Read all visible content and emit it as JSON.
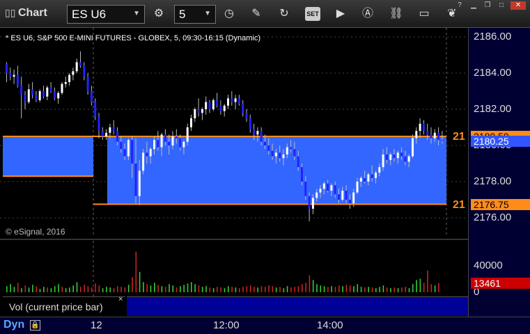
{
  "toolbar": {
    "app_title": "Chart",
    "symbol": "ES U6",
    "interval": "5"
  },
  "chart": {
    "title": "* ES U6, S&P 500 E-MINI FUTURES - GLOBEX, 5, 09:30-16:15 (Dynamic)",
    "copyright": "© eSignal, 2016",
    "price_ticks": [
      "2186.00",
      "2184.00",
      "2182.00",
      "2180.00",
      "2178.00",
      "2176.00"
    ],
    "last_price_tag": "2180.25",
    "upper_level_tag": "2180.50",
    "lower_level_tag": "2176.75",
    "level_prefix": "21",
    "volume_ticks": [
      "40000",
      "0"
    ],
    "volume_tag": "13461",
    "volume_label": "Vol (current price bar)",
    "volume_close": "×",
    "time_labels": [
      "12",
      "12:00",
      "14:00"
    ],
    "dyn_label": "Dyn",
    "colors": {
      "up_candle": "#ffffff",
      "down_candle": "#2222ff",
      "band": "#3366ff",
      "level_line": "#ff8c1a",
      "vol_up": "#33cc33",
      "vol_down": "#cc2222"
    }
  },
  "chart_data": {
    "type": "candlestick",
    "ylim": [
      2175.5,
      2186.3
    ],
    "upper_level": 2180.5,
    "lower_level": 2176.75,
    "last_price": 2180.25,
    "session_break_index": 34,
    "candles": [
      [
        2184.5,
        2184.6,
        2183.5,
        2184.0
      ],
      [
        2184.0,
        2184.3,
        2183.6,
        2183.8
      ],
      [
        2183.8,
        2184.2,
        2183.4,
        2183.9
      ],
      [
        2183.9,
        2184.4,
        2183.2,
        2183.3
      ],
      [
        2183.3,
        2183.8,
        2181.5,
        2182.8
      ],
      [
        2182.8,
        2183.0,
        2182.0,
        2182.4
      ],
      [
        2182.4,
        2183.4,
        2182.3,
        2183.1
      ],
      [
        2183.1,
        2183.5,
        2182.6,
        2182.8
      ],
      [
        2182.8,
        2183.0,
        2182.4,
        2182.5
      ],
      [
        2182.5,
        2183.1,
        2182.4,
        2183.0
      ],
      [
        2183.0,
        2183.3,
        2182.6,
        2182.7
      ],
      [
        2182.7,
        2183.3,
        2182.5,
        2183.2
      ],
      [
        2183.2,
        2183.5,
        2182.9,
        2183.0
      ],
      [
        2183.0,
        2183.2,
        2182.5,
        2182.6
      ],
      [
        2182.6,
        2183.0,
        2182.3,
        2182.9
      ],
      [
        2182.9,
        2183.5,
        2182.8,
        2183.4
      ],
      [
        2183.4,
        2183.8,
        2183.2,
        2183.5
      ],
      [
        2183.5,
        2184.0,
        2183.3,
        2183.9
      ],
      [
        2183.9,
        2184.3,
        2183.6,
        2184.1
      ],
      [
        2184.1,
        2184.8,
        2184.0,
        2184.6
      ],
      [
        2184.6,
        2185.2,
        2184.3,
        2184.4
      ],
      [
        2184.4,
        2184.6,
        2183.6,
        2183.8
      ],
      [
        2183.8,
        2184.0,
        2182.8,
        2183.0
      ],
      [
        2183.0,
        2183.3,
        2182.2,
        2182.4
      ],
      [
        2182.4,
        2182.6,
        2181.4,
        2181.6
      ],
      [
        2181.6,
        2181.8,
        2180.4,
        2180.8
      ],
      [
        2180.8,
        2181.0,
        2180.3,
        2180.5
      ],
      [
        2180.5,
        2180.9,
        2180.3,
        2180.7
      ],
      [
        2180.7,
        2181.2,
        2180.4,
        2181.0
      ],
      [
        2181.0,
        2181.4,
        2180.6,
        2180.8
      ],
      [
        2180.8,
        2181.0,
        2180.0,
        2180.2
      ],
      [
        2180.2,
        2180.5,
        2179.6,
        2179.8
      ],
      [
        2179.8,
        2180.1,
        2179.2,
        2179.4
      ],
      [
        2179.4,
        2180.4,
        2179.2,
        2180.3
      ],
      [
        2180.3,
        2180.5,
        2178.2,
        2179.0
      ],
      [
        2179.0,
        2180.4,
        2176.8,
        2177.2
      ],
      [
        2177.2,
        2179.2,
        2176.7,
        2178.6
      ],
      [
        2178.6,
        2179.8,
        2178.4,
        2179.6
      ],
      [
        2179.6,
        2180.2,
        2179.0,
        2179.4
      ],
      [
        2179.4,
        2179.9,
        2179.0,
        2179.8
      ],
      [
        2179.8,
        2180.5,
        2179.5,
        2180.3
      ],
      [
        2180.3,
        2180.8,
        2179.7,
        2179.9
      ],
      [
        2179.9,
        2180.7,
        2179.4,
        2180.6
      ],
      [
        2180.6,
        2180.9,
        2180.0,
        2180.2
      ],
      [
        2180.2,
        2180.6,
        2179.5,
        2180.0
      ],
      [
        2180.0,
        2180.8,
        2179.8,
        2180.5
      ],
      [
        2180.5,
        2180.9,
        2180.1,
        2180.4
      ],
      [
        2180.4,
        2180.6,
        2179.7,
        2179.9
      ],
      [
        2179.9,
        2180.3,
        2179.5,
        2180.2
      ],
      [
        2180.2,
        2181.2,
        2180.0,
        2181.0
      ],
      [
        2181.0,
        2181.7,
        2180.8,
        2181.5
      ],
      [
        2181.5,
        2182.1,
        2181.3,
        2182.0
      ],
      [
        2182.0,
        2182.6,
        2181.6,
        2181.8
      ],
      [
        2181.8,
        2182.1,
        2181.4,
        2182.0
      ],
      [
        2182.0,
        2182.7,
        2181.7,
        2182.4
      ],
      [
        2182.4,
        2182.5,
        2181.8,
        2182.0
      ],
      [
        2182.0,
        2182.6,
        2181.9,
        2182.5
      ],
      [
        2182.5,
        2182.9,
        2182.1,
        2182.2
      ],
      [
        2182.2,
        2182.5,
        2181.7,
        2181.9
      ],
      [
        2181.9,
        2182.3,
        2181.6,
        2182.2
      ],
      [
        2182.2,
        2182.8,
        2182.0,
        2182.6
      ],
      [
        2182.6,
        2183.0,
        2182.2,
        2182.4
      ],
      [
        2182.4,
        2182.8,
        2182.0,
        2182.6
      ],
      [
        2182.6,
        2182.8,
        2182.2,
        2182.3
      ],
      [
        2182.3,
        2182.5,
        2181.6,
        2181.8
      ],
      [
        2181.8,
        2182.0,
        2181.3,
        2181.5
      ],
      [
        2181.5,
        2181.7,
        2180.7,
        2180.9
      ],
      [
        2180.9,
        2181.2,
        2180.3,
        2180.6
      ],
      [
        2180.6,
        2181.0,
        2180.2,
        2180.8
      ],
      [
        2180.8,
        2181.0,
        2180.0,
        2180.2
      ],
      [
        2180.2,
        2180.6,
        2179.8,
        2180.0
      ],
      [
        2180.0,
        2180.4,
        2179.5,
        2179.7
      ],
      [
        2179.7,
        2180.1,
        2179.2,
        2179.4
      ],
      [
        2179.4,
        2179.8,
        2179.0,
        2179.6
      ],
      [
        2179.6,
        2180.0,
        2179.1,
        2179.3
      ],
      [
        2179.3,
        2179.8,
        2178.9,
        2179.5
      ],
      [
        2179.5,
        2180.1,
        2179.3,
        2179.9
      ],
      [
        2179.9,
        2180.3,
        2179.6,
        2179.8
      ],
      [
        2179.8,
        2180.2,
        2179.2,
        2179.4
      ],
      [
        2179.4,
        2179.7,
        2178.6,
        2178.8
      ],
      [
        2178.8,
        2179.0,
        2177.8,
        2178.0
      ],
      [
        2178.0,
        2178.3,
        2177.0,
        2177.2
      ],
      [
        2177.2,
        2177.4,
        2175.8,
        2176.5
      ],
      [
        2176.5,
        2177.3,
        2176.2,
        2177.1
      ],
      [
        2177.1,
        2177.6,
        2176.9,
        2177.4
      ],
      [
        2177.4,
        2177.8,
        2177.1,
        2177.6
      ],
      [
        2177.6,
        2178.0,
        2177.3,
        2177.9
      ],
      [
        2177.9,
        2178.1,
        2177.4,
        2177.5
      ],
      [
        2177.5,
        2177.9,
        2177.2,
        2177.8
      ],
      [
        2177.8,
        2178.0,
        2177.1,
        2177.3
      ],
      [
        2177.3,
        2177.6,
        2176.8,
        2177.0
      ],
      [
        2177.0,
        2177.7,
        2176.9,
        2177.5
      ],
      [
        2177.5,
        2177.8,
        2176.8,
        2177.0
      ],
      [
        2177.0,
        2177.3,
        2176.5,
        2176.8
      ],
      [
        2176.8,
        2177.6,
        2176.6,
        2177.4
      ],
      [
        2177.4,
        2178.2,
        2177.3,
        2178.0
      ],
      [
        2178.0,
        2178.3,
        2177.7,
        2178.2
      ],
      [
        2178.2,
        2178.6,
        2177.9,
        2178.0
      ],
      [
        2178.0,
        2178.5,
        2177.8,
        2178.4
      ],
      [
        2178.4,
        2178.9,
        2178.0,
        2178.2
      ],
      [
        2178.2,
        2178.6,
        2177.9,
        2178.5
      ],
      [
        2178.5,
        2179.0,
        2178.3,
        2178.8
      ],
      [
        2178.8,
        2179.8,
        2178.6,
        2179.5
      ],
      [
        2179.5,
        2179.9,
        2179.0,
        2179.2
      ],
      [
        2179.2,
        2179.6,
        2178.9,
        2179.5
      ],
      [
        2179.5,
        2179.8,
        2179.1,
        2179.3
      ],
      [
        2179.3,
        2179.7,
        2179.0,
        2179.6
      ],
      [
        2179.6,
        2179.9,
        2179.2,
        2179.4
      ],
      [
        2179.4,
        2179.7,
        2178.9,
        2179.1
      ],
      [
        2179.1,
        2179.5,
        2178.8,
        2179.4
      ],
      [
        2179.4,
        2180.6,
        2179.3,
        2180.4
      ],
      [
        2180.4,
        2181.0,
        2180.1,
        2180.8
      ],
      [
        2180.8,
        2181.5,
        2180.4,
        2181.2
      ],
      [
        2181.2,
        2181.4,
        2180.6,
        2180.8
      ],
      [
        2180.8,
        2181.2,
        2180.3,
        2180.6
      ],
      [
        2180.6,
        2181.0,
        2180.1,
        2180.4
      ],
      [
        2180.4,
        2180.9,
        2180.2,
        2180.7
      ],
      [
        2180.7,
        2181.0,
        2180.0,
        2180.3
      ],
      [
        2180.3,
        2180.8,
        2180.1,
        2180.25
      ]
    ],
    "volume": [
      [
        9000,
        0
      ],
      [
        12000,
        0
      ],
      [
        8000,
        0
      ],
      [
        14000,
        1
      ],
      [
        6000,
        0
      ],
      [
        10000,
        1
      ],
      [
        7000,
        0
      ],
      [
        11000,
        0
      ],
      [
        9000,
        1
      ],
      [
        5000,
        0
      ],
      [
        8000,
        0
      ],
      [
        7000,
        1
      ],
      [
        6000,
        0
      ],
      [
        9000,
        0
      ],
      [
        12000,
        0
      ],
      [
        8000,
        1
      ],
      [
        6000,
        0
      ],
      [
        7000,
        0
      ],
      [
        10000,
        0
      ],
      [
        15000,
        0
      ],
      [
        8000,
        1
      ],
      [
        11000,
        1
      ],
      [
        9000,
        1
      ],
      [
        7000,
        1
      ],
      [
        13000,
        1
      ],
      [
        10000,
        1
      ],
      [
        6000,
        0
      ],
      [
        8000,
        0
      ],
      [
        7000,
        0
      ],
      [
        6000,
        1
      ],
      [
        9000,
        1
      ],
      [
        8000,
        1
      ],
      [
        7000,
        1
      ],
      [
        11000,
        0
      ],
      [
        22000,
        1
      ],
      [
        60000,
        1
      ],
      [
        30000,
        0
      ],
      [
        15000,
        0
      ],
      [
        12000,
        1
      ],
      [
        10000,
        0
      ],
      [
        14000,
        0
      ],
      [
        11000,
        1
      ],
      [
        9000,
        0
      ],
      [
        8000,
        1
      ],
      [
        12000,
        0
      ],
      [
        10000,
        0
      ],
      [
        7000,
        1
      ],
      [
        9000,
        0
      ],
      [
        11000,
        0
      ],
      [
        13000,
        0
      ],
      [
        15000,
        0
      ],
      [
        12000,
        0
      ],
      [
        10000,
        1
      ],
      [
        8000,
        0
      ],
      [
        9000,
        0
      ],
      [
        7000,
        1
      ],
      [
        6000,
        0
      ],
      [
        8000,
        1
      ],
      [
        7000,
        1
      ],
      [
        6000,
        0
      ],
      [
        9000,
        0
      ],
      [
        8000,
        1
      ],
      [
        7000,
        0
      ],
      [
        6000,
        1
      ],
      [
        8000,
        1
      ],
      [
        9000,
        1
      ],
      [
        10000,
        1
      ],
      [
        8000,
        1
      ],
      [
        7000,
        0
      ],
      [
        9000,
        1
      ],
      [
        8000,
        1
      ],
      [
        10000,
        1
      ],
      [
        9000,
        1
      ],
      [
        7000,
        0
      ],
      [
        8000,
        1
      ],
      [
        6000,
        0
      ],
      [
        9000,
        0
      ],
      [
        7000,
        1
      ],
      [
        8000,
        1
      ],
      [
        9000,
        1
      ],
      [
        12000,
        1
      ],
      [
        14000,
        1
      ],
      [
        25000,
        1
      ],
      [
        18000,
        0
      ],
      [
        12000,
        0
      ],
      [
        10000,
        0
      ],
      [
        9000,
        0
      ],
      [
        8000,
        1
      ],
      [
        9000,
        0
      ],
      [
        8000,
        1
      ],
      [
        10000,
        1
      ],
      [
        9000,
        0
      ],
      [
        11000,
        1
      ],
      [
        10000,
        1
      ],
      [
        9000,
        0
      ],
      [
        12000,
        0
      ],
      [
        8000,
        0
      ],
      [
        7000,
        1
      ],
      [
        8000,
        0
      ],
      [
        7000,
        1
      ],
      [
        6000,
        0
      ],
      [
        8000,
        0
      ],
      [
        10000,
        0
      ],
      [
        7000,
        1
      ],
      [
        6000,
        0
      ],
      [
        7000,
        1
      ],
      [
        6000,
        0
      ],
      [
        7000,
        1
      ],
      [
        8000,
        1
      ],
      [
        6000,
        0
      ],
      [
        12000,
        0
      ],
      [
        18000,
        0
      ],
      [
        20000,
        0
      ],
      [
        14000,
        1
      ],
      [
        32000,
        1
      ],
      [
        12000,
        1
      ],
      [
        10000,
        0
      ],
      [
        13461,
        1
      ]
    ]
  }
}
